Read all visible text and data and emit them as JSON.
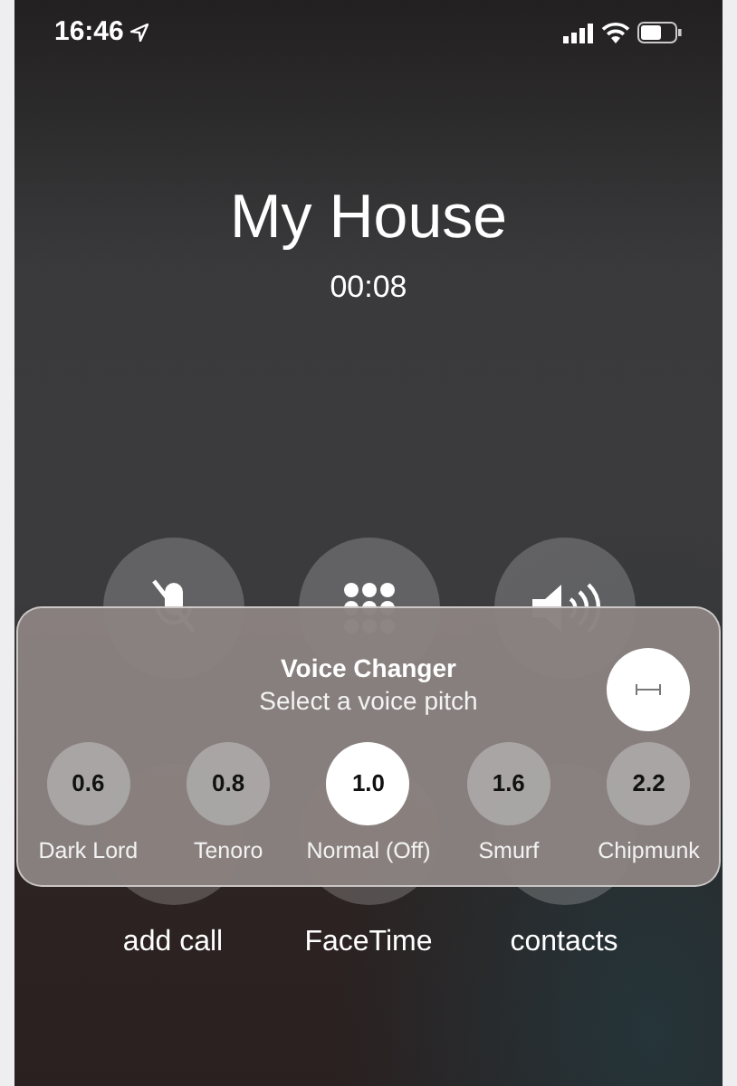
{
  "status_bar": {
    "time": "16:46"
  },
  "call": {
    "name": "My House",
    "duration": "00:08"
  },
  "controls": [
    {
      "kind": "mute"
    },
    {
      "kind": "keypad"
    },
    {
      "kind": "speaker"
    }
  ],
  "voice_changer": {
    "title": "Voice Changer",
    "subtitle": "Select a voice pitch",
    "pitches": [
      {
        "value": "0.6",
        "label": "Dark Lord",
        "selected": false
      },
      {
        "value": "0.8",
        "label": "Tenoro",
        "selected": false
      },
      {
        "value": "1.0",
        "label": "Normal (Off)",
        "selected": true
      },
      {
        "value": "1.6",
        "label": "Smurf",
        "selected": false
      },
      {
        "value": "2.2",
        "label": "Chipmunk",
        "selected": false
      }
    ]
  },
  "bottom_buttons": [
    {
      "label": "add call"
    },
    {
      "label": "FaceTime"
    },
    {
      "label": "contacts"
    }
  ]
}
